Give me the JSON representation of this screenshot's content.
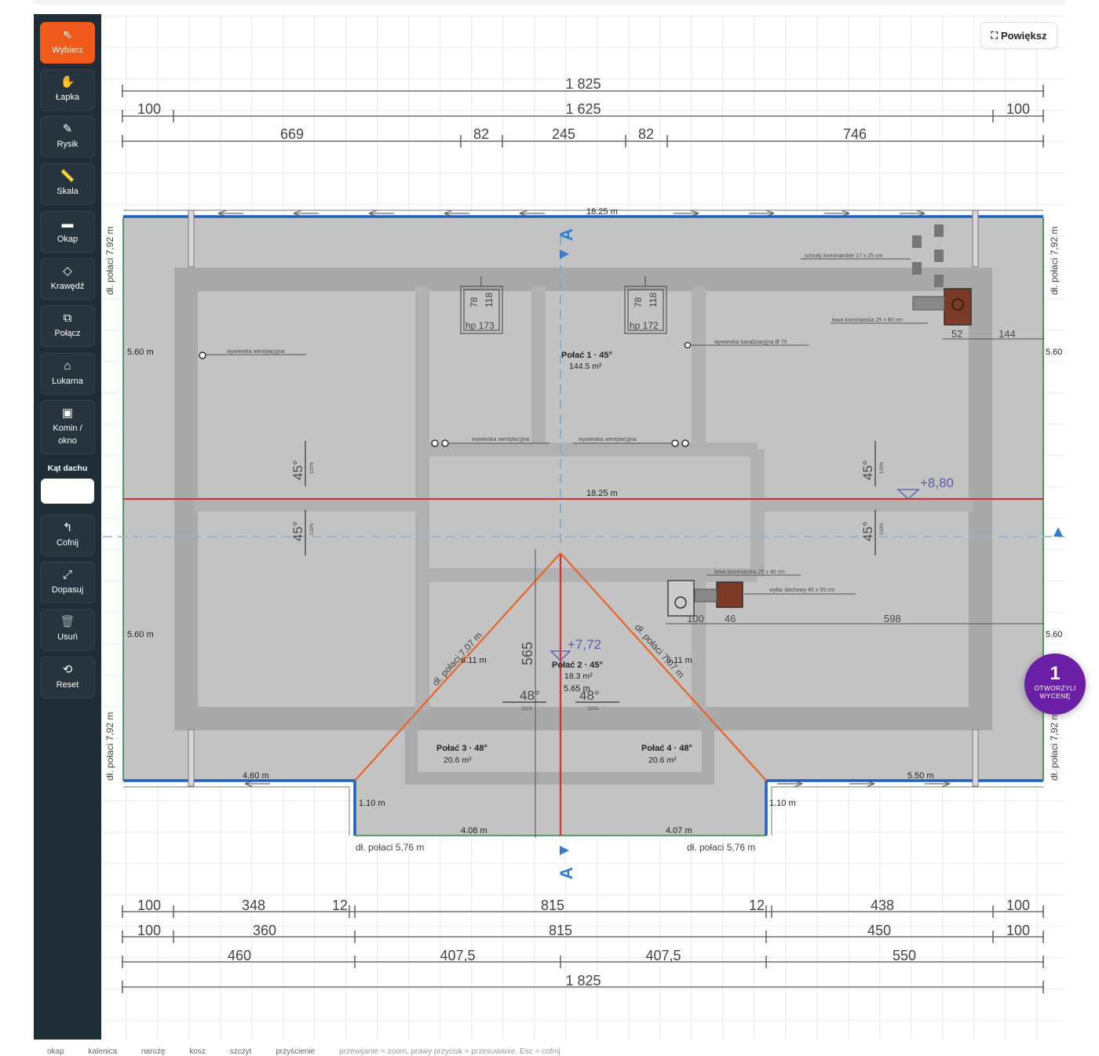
{
  "toolbar": {
    "tools": [
      {
        "label": "Wybierz",
        "icon": "cursor-icon"
      },
      {
        "label": "Łapka",
        "icon": "hand-icon"
      },
      {
        "label": "Rysik",
        "icon": "pencil-icon"
      },
      {
        "label": "Skala",
        "icon": "ruler-icon"
      },
      {
        "label": "Okap",
        "icon": "eave-icon"
      },
      {
        "label": "Krawędź",
        "icon": "diamond-icon"
      },
      {
        "label": "Połącz",
        "icon": "merge-icon"
      },
      {
        "label": "Lukarna",
        "icon": "house-icon"
      },
      {
        "label": "Komin / okno",
        "icon": "square-icon"
      }
    ],
    "angle_label": "Kąt dachu",
    "angle_value": "",
    "actions": [
      {
        "label": "Cofnij",
        "icon": "undo-icon"
      },
      {
        "label": "Dopasuj",
        "icon": "fit-icon"
      },
      {
        "label": "Usuń",
        "icon": "trash-icon"
      },
      {
        "label": "Reset",
        "icon": "reset-icon"
      }
    ]
  },
  "canvas": {
    "zoom_button": "Powiększ",
    "dims_top": {
      "total": "1 825",
      "inner": "1 625",
      "left_off": "100",
      "right_off": "100",
      "segments": [
        "669",
        "82",
        "245",
        "82",
        "746"
      ]
    },
    "dims_bottom": {
      "row1": [
        "100",
        "348",
        "12",
        "815",
        "12",
        "438",
        "100"
      ],
      "row2": [
        "100",
        "360",
        "815",
        "450",
        "100"
      ],
      "row3": [
        "460",
        "407,5",
        "407,5",
        "550"
      ],
      "row4": "1 825"
    },
    "edge_labels": {
      "top": "18.25 m",
      "middle": "18.25 m",
      "left_upper": "5.60 m",
      "left_lower": "5.60 m",
      "right_upper": "5.60",
      "right_lower": "5.60",
      "bottom_left": "4.60 m",
      "bottom_right": "5.50 m",
      "wing_left_h": "1.10 m",
      "wing_right_h": "1.10 m",
      "wing_bottom_left": "4.08 m",
      "wing_bottom_right": "4.07 m",
      "hip_left_len": "6.11 m",
      "hip_right_len": "6.11 m",
      "ridge_len": "5.65 m",
      "wing_len_left": "dł. połaci  5,76 m",
      "wing_len_right": "dł. połaci  5,76 m",
      "side_len": "dł. połaci  7,92 m",
      "hip_len": "dł. połaci 7,07 m"
    },
    "roof_planes": [
      {
        "name": "Połać 1 · 45°",
        "area": "144.5 m²"
      },
      {
        "name": "Połać 2 · 45°",
        "area": "18.3 m²"
      },
      {
        "name": "Połać 3 · 48°",
        "area": "20.6 m²"
      },
      {
        "name": "Połać 4 · 48°",
        "area": "20.6 m²"
      }
    ],
    "plan_annotations": {
      "elev_top": "+8,80",
      "elev_mid": "+7,72",
      "dim_565": "565",
      "pitch_45": "45°",
      "pitch_48": "48°",
      "pct_100": "100%",
      "pct_111": "111%",
      "window_a": [
        "78",
        "118",
        "hp 173"
      ],
      "window_b": [
        "78",
        "118",
        "hp 172"
      ],
      "notes": [
        "wywiewka wentylacyjna",
        "wywiewka wentylacyjna",
        "wywiewka wentylacyjna",
        "wywiewka kanalizacyjna Ø 75",
        "schody kominiarskie 17 x 25 cm",
        "ława kominiarska 25 x 60 cm",
        "ława kominiarska 25 x 40 cm",
        "wyłaz dachowy 46 x 55 cm"
      ],
      "dims_small": [
        "52",
        "144",
        "100",
        "46",
        "598"
      ],
      "section": "A"
    }
  },
  "badge": {
    "count": "1",
    "text": "OTWORZYLI WYCENĘ"
  },
  "bottom_tabs": [
    "okap",
    "kalenica",
    "narożę",
    "kosz",
    "szczyt",
    "przyścienie"
  ],
  "bottom_hint": "przewijanie = zoom, prawy przycisk = przesuwanie, Esc = cofnij"
}
